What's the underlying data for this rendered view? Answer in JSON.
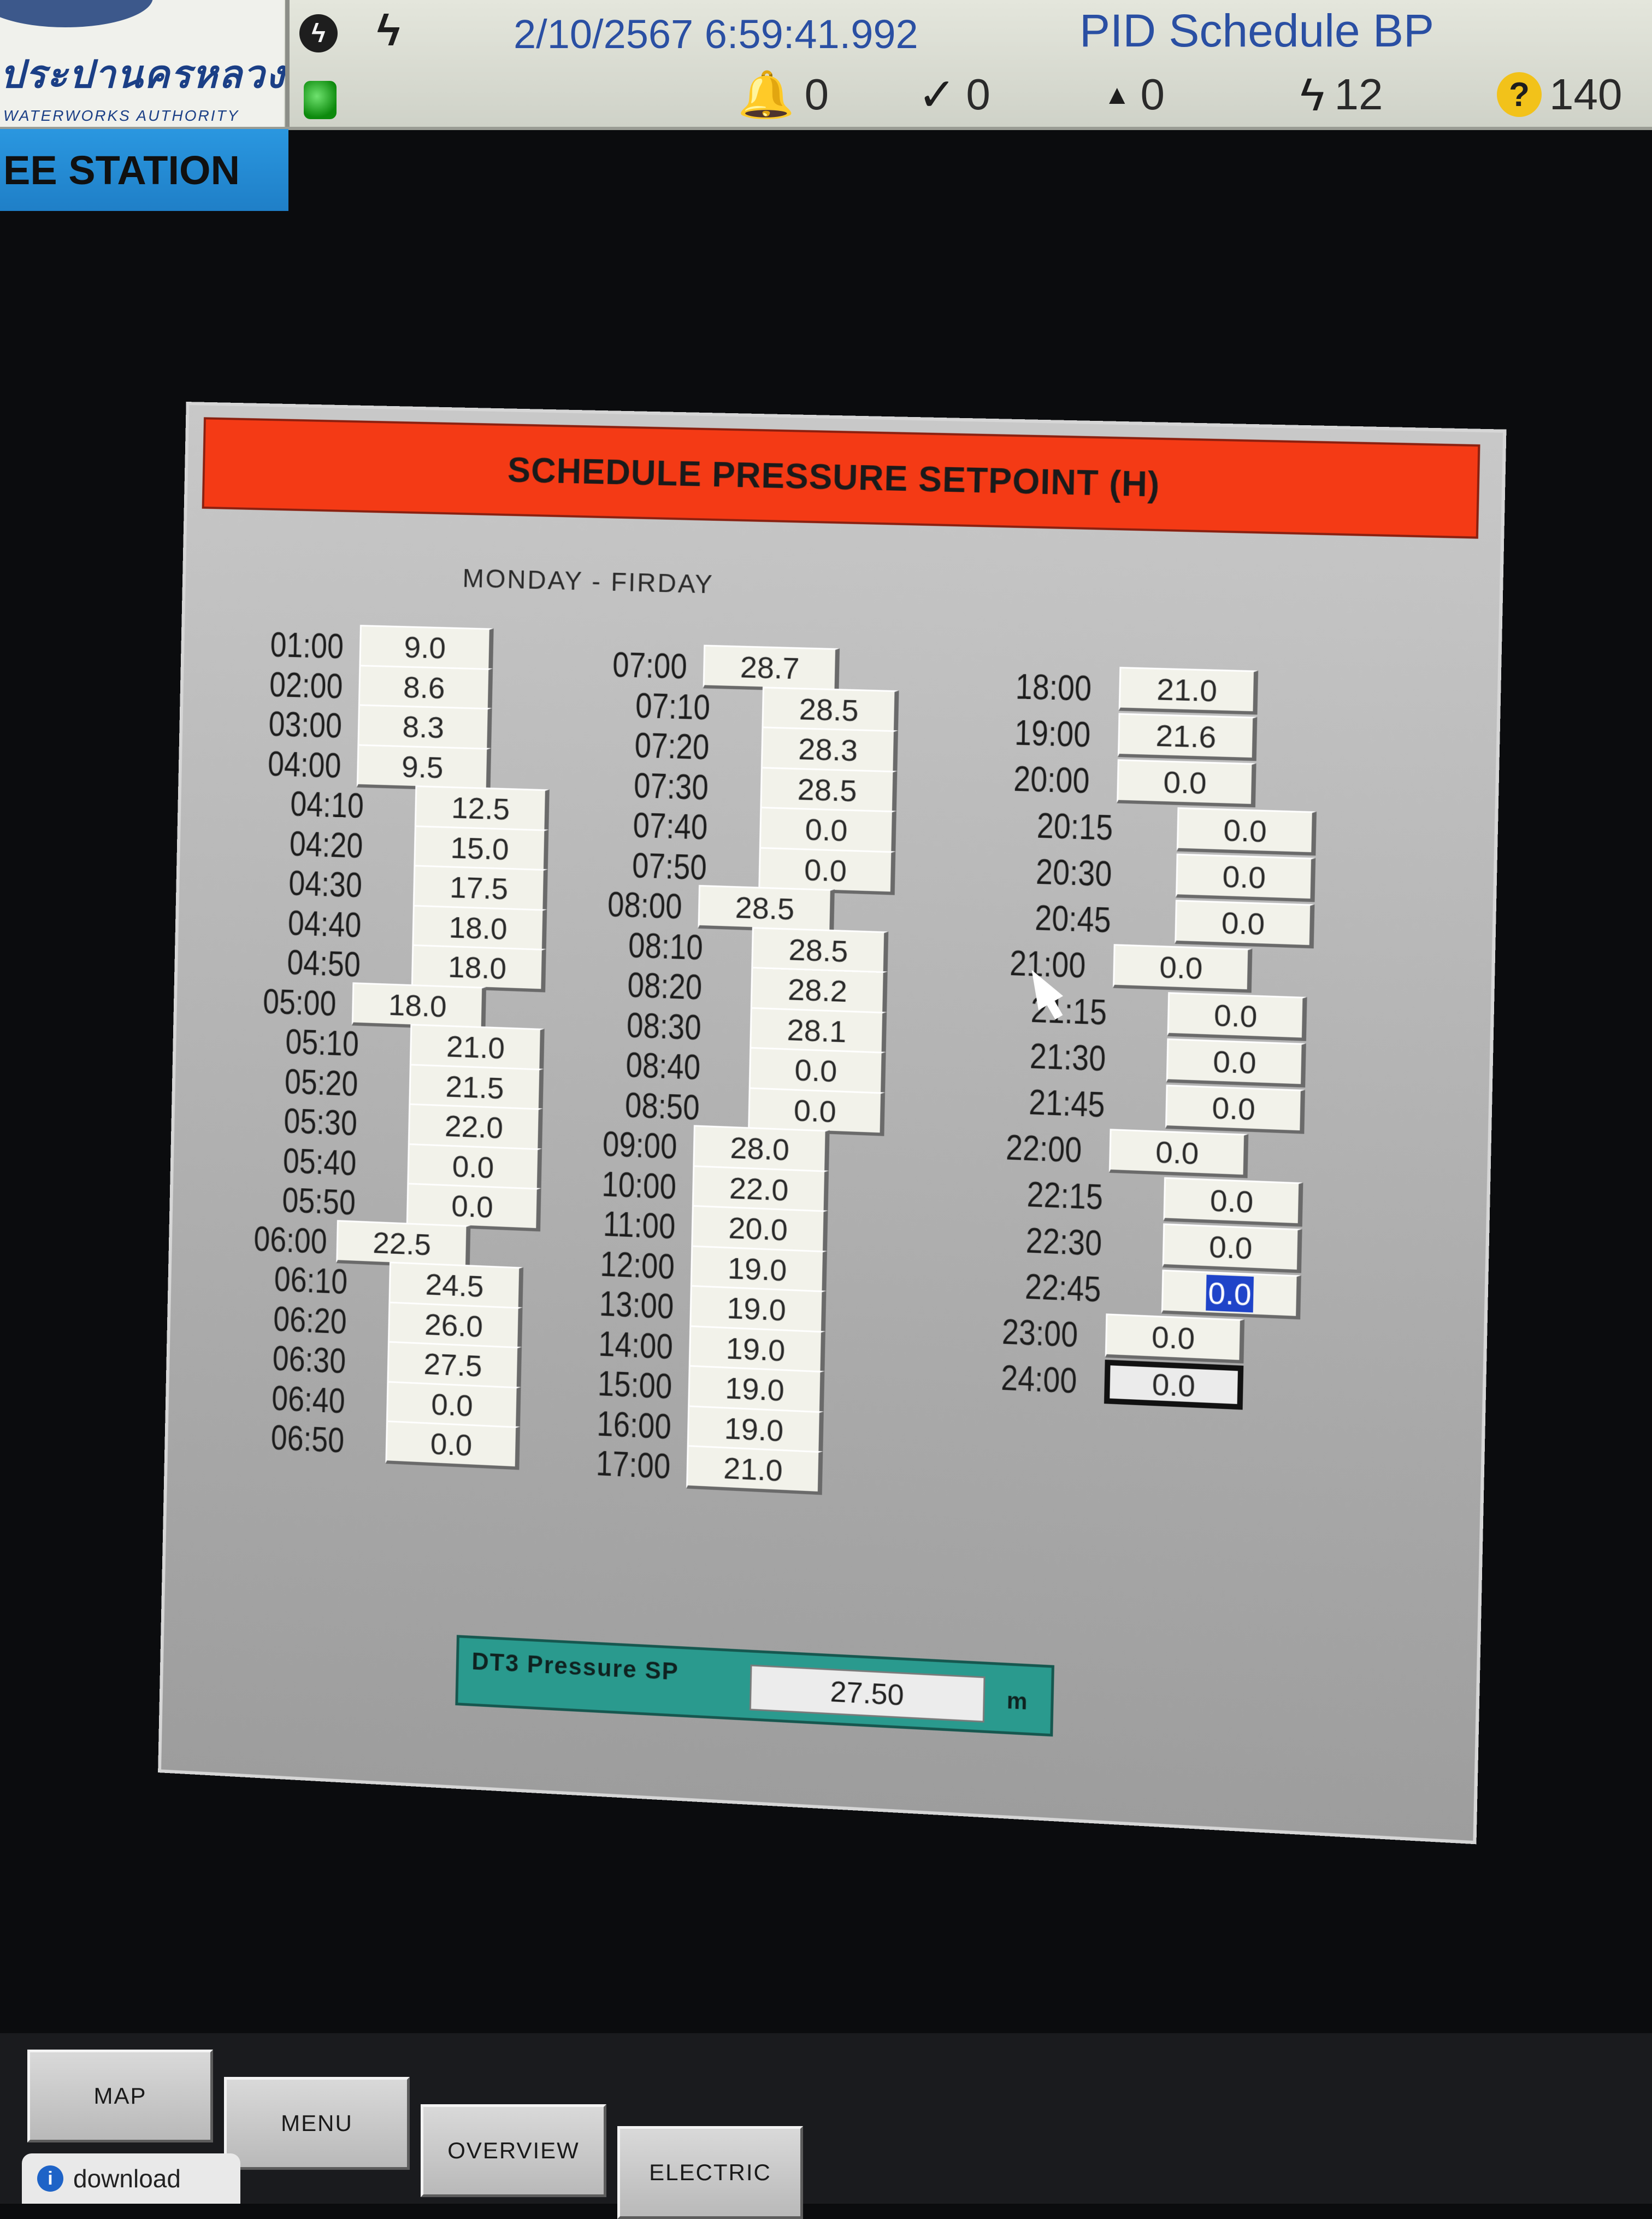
{
  "header": {
    "logo_thai": "ประปานครหลวง",
    "logo_eng": "WATERWORKS AUTHORITY",
    "datetime": "2/10/2567 6:59:41.992",
    "screen_name": "PID Schedule BP",
    "counters": [
      {
        "icon": "bell-icon",
        "glyph": "🔔",
        "value": "0"
      },
      {
        "icon": "check-bolt-icon",
        "glyph": "✓",
        "value": "0"
      },
      {
        "icon": "up-arrow-icon",
        "glyph": "▲",
        "value": "0"
      },
      {
        "icon": "lightning-icon",
        "glyph": "ϟ",
        "value": "12"
      },
      {
        "icon": "question-icon",
        "glyph": "?",
        "value": "140"
      }
    ]
  },
  "station_tab": "EE STATION",
  "panel": {
    "title": "SCHEDULE PRESSURE SETPOINT (H)",
    "day_label": "MONDAY - FIRDAY",
    "columns": [
      {
        "rows": [
          {
            "time": "01:00",
            "value": "9.0"
          },
          {
            "time": "02:00",
            "value": "8.6"
          },
          {
            "time": "03:00",
            "value": "8.3"
          },
          {
            "time": "04:00",
            "value": "9.5"
          },
          {
            "time": "04:10",
            "value": "12.5"
          },
          {
            "time": "04:20",
            "value": "15.0"
          },
          {
            "time": "04:30",
            "value": "17.5"
          },
          {
            "time": "04:40",
            "value": "18.0"
          },
          {
            "time": "04:50",
            "value": "18.0"
          },
          {
            "time": "05:00",
            "value": "18.0"
          },
          {
            "time": "05:10",
            "value": "21.0"
          },
          {
            "time": "05:20",
            "value": "21.5"
          },
          {
            "time": "05:30",
            "value": "22.0"
          },
          {
            "time": "05:40",
            "value": "0.0"
          },
          {
            "time": "05:50",
            "value": "0.0"
          },
          {
            "time": "06:00",
            "value": "22.5"
          },
          {
            "time": "06:10",
            "value": "24.5"
          },
          {
            "time": "06:20",
            "value": "26.0"
          },
          {
            "time": "06:30",
            "value": "27.5"
          },
          {
            "time": "06:40",
            "value": "0.0"
          },
          {
            "time": "06:50",
            "value": "0.0"
          }
        ]
      },
      {
        "rows": [
          {
            "time": "07:00",
            "value": "28.7"
          },
          {
            "time": "07:10",
            "value": "28.5"
          },
          {
            "time": "07:20",
            "value": "28.3"
          },
          {
            "time": "07:30",
            "value": "28.5"
          },
          {
            "time": "07:40",
            "value": "0.0"
          },
          {
            "time": "07:50",
            "value": "0.0"
          },
          {
            "time": "08:00",
            "value": "28.5"
          },
          {
            "time": "08:10",
            "value": "28.5"
          },
          {
            "time": "08:20",
            "value": "28.2"
          },
          {
            "time": "08:30",
            "value": "28.1"
          },
          {
            "time": "08:40",
            "value": "0.0"
          },
          {
            "time": "08:50",
            "value": "0.0"
          },
          {
            "time": "09:00",
            "value": "28.0"
          },
          {
            "time": "10:00",
            "value": "22.0"
          },
          {
            "time": "11:00",
            "value": "20.0"
          },
          {
            "time": "12:00",
            "value": "19.0"
          },
          {
            "time": "13:00",
            "value": "19.0"
          },
          {
            "time": "14:00",
            "value": "19.0"
          },
          {
            "time": "15:00",
            "value": "19.0"
          },
          {
            "time": "16:00",
            "value": "19.0"
          },
          {
            "time": "17:00",
            "value": "21.0"
          }
        ]
      },
      {
        "rows": [
          {
            "time": "18:00",
            "value": "21.0"
          },
          {
            "time": "19:00",
            "value": "21.6"
          },
          {
            "time": "20:00",
            "value": "0.0"
          },
          {
            "time": "20:15",
            "value": "0.0"
          },
          {
            "time": "20:30",
            "value": "0.0"
          },
          {
            "time": "20:45",
            "value": "0.0"
          },
          {
            "time": "21:00",
            "value": "0.0"
          },
          {
            "time": "21:15",
            "value": "0.0"
          },
          {
            "time": "21:30",
            "value": "0.0"
          },
          {
            "time": "21:45",
            "value": "0.0"
          },
          {
            "time": "22:00",
            "value": "0.0"
          },
          {
            "time": "22:15",
            "value": "0.0"
          },
          {
            "time": "22:30",
            "value": "0.0"
          },
          {
            "time": "22:45",
            "value": "0.0"
          },
          {
            "time": "23:00",
            "value": "0.0"
          },
          {
            "time": "24:00",
            "value": "0.0"
          }
        ]
      }
    ],
    "selected_time": "22:45",
    "focused_time": "24:00"
  },
  "dt3": {
    "label": "DT3 Pressure SP",
    "value": "27.50",
    "unit": "m"
  },
  "nav": {
    "buttons": [
      "MAP",
      "MENU",
      "OVERVIEW",
      "ELECTRIC"
    ],
    "download_label": "download"
  }
}
